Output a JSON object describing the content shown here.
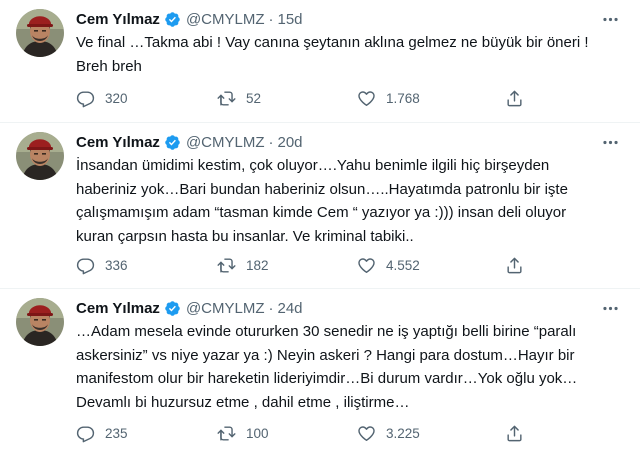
{
  "colors": {
    "verified": "#1d9bf0",
    "secondary_text": "#536471",
    "divider": "#eff3f4"
  },
  "icons": {
    "verified": "verified-badge-icon",
    "more": "more-dots-icon",
    "reply": "reply-icon",
    "retweet": "retweet-icon",
    "like": "heart-icon",
    "share": "share-icon"
  },
  "tweets": [
    {
      "name": "Cem Yılmaz",
      "handle": "@CMYLMZ",
      "separator": "·",
      "time": "15d",
      "lines": [
        "Ve final …Takma abi ! Vay canına şeytanın aklına gelmez ne büyük bir öneri !",
        "Breh breh"
      ],
      "replies": "320",
      "retweets": "52",
      "likes": "1.768"
    },
    {
      "name": "Cem Yılmaz",
      "handle": "@CMYLMZ",
      "separator": "·",
      "time": "20d",
      "lines": [
        "İnsandan ümidimi kestim, çok oluyor….Yahu benimle ilgili hiç birşeyden",
        "haberiniz yok…Bari  bundan haberiniz olsun…..Hayatımda patronlu bir işte",
        "çalışmamışım adam “tasman kimde Cem “ yazıyor ya :))) insan deli oluyor",
        "kuran çarpsın hasta bu insanlar. Ve kriminal tabiki.."
      ],
      "replies": "336",
      "retweets": "182",
      "likes": "4.552"
    },
    {
      "name": "Cem Yılmaz",
      "handle": "@CMYLMZ",
      "separator": "·",
      "time": "24d",
      "lines": [
        "…Adam mesela evinde otururken 30 senedir ne iş yaptığı belli birine “paralı",
        "askersiniz” vs niye yazar ya :) Neyin askeri ? Hangi para dostum…Hayır bir",
        "manifestom olur bir hareketin lideriyimdir…Bi durum vardır…Yok oğlu yok…",
        "Devamlı bi huzursuz etme , dahil etme , iliştirme…"
      ],
      "replies": "235",
      "retweets": "100",
      "likes": "3.225"
    }
  ]
}
